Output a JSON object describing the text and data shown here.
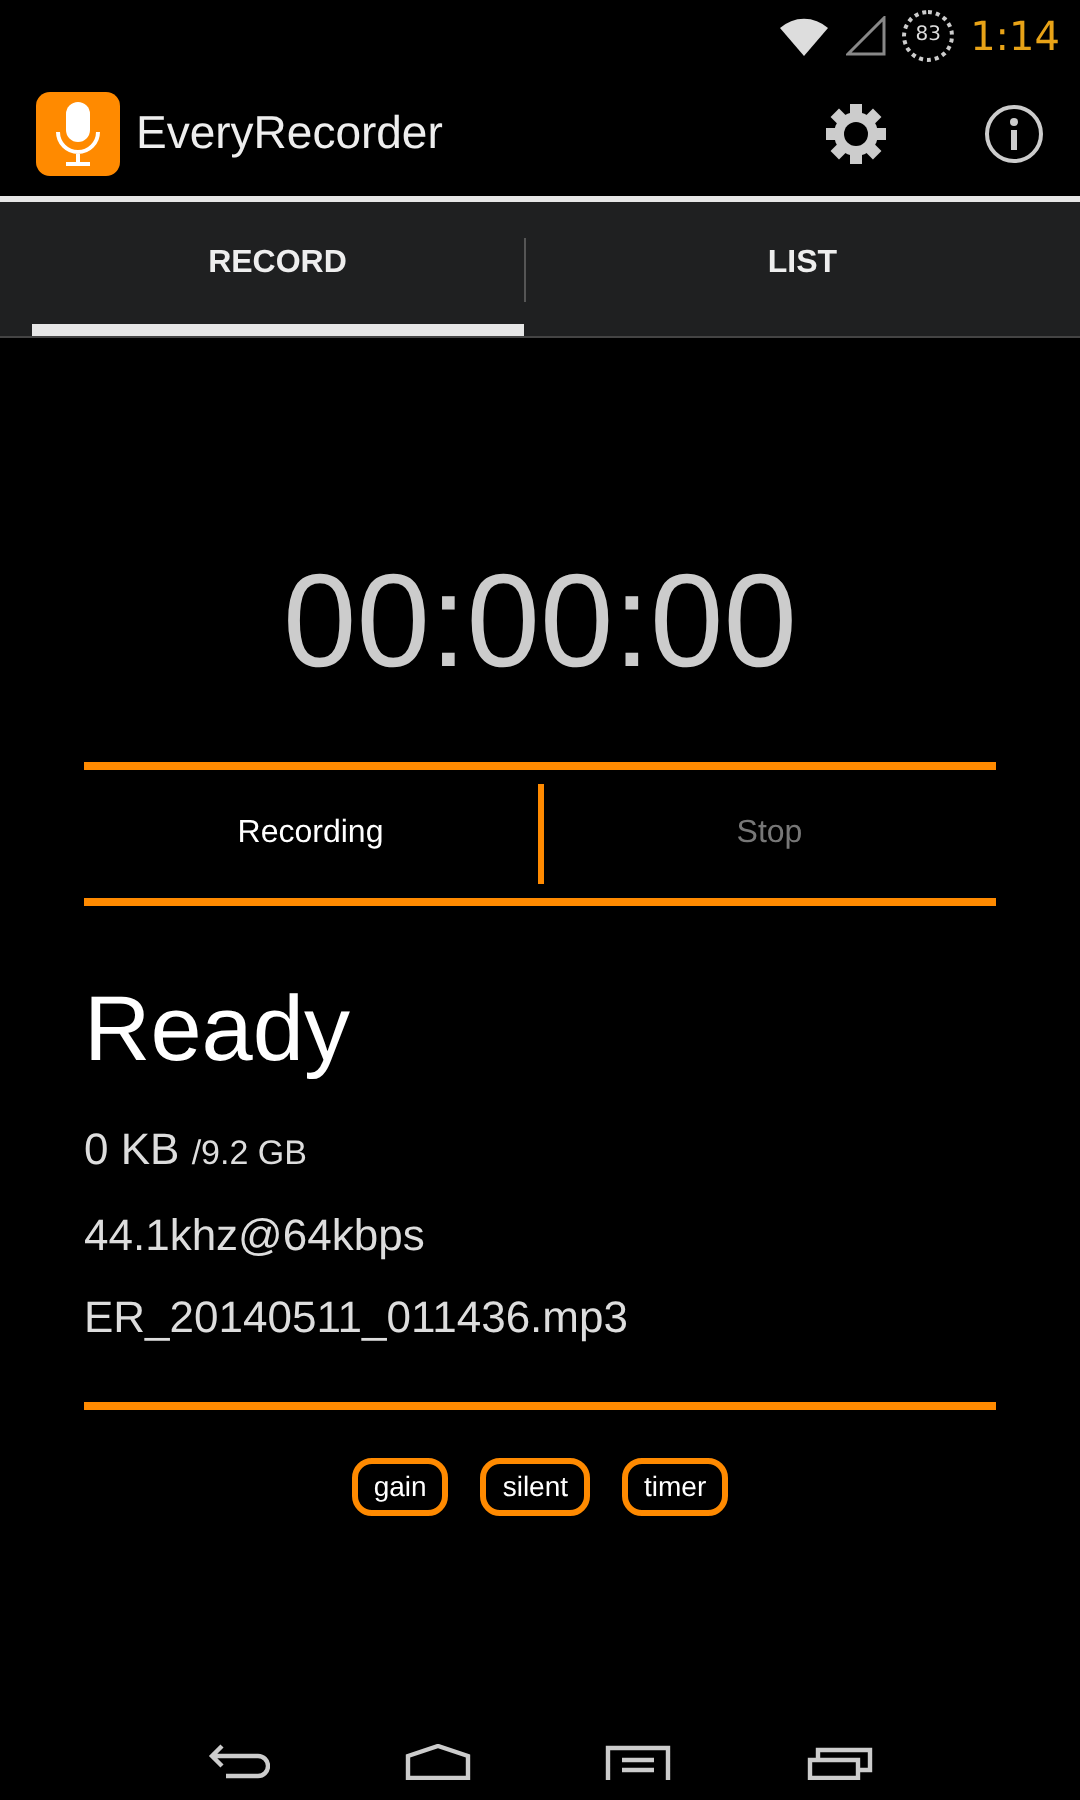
{
  "status_bar": {
    "battery": "83",
    "time": "1:14"
  },
  "app_bar": {
    "title": "EveryRecorder"
  },
  "tabs": [
    {
      "label": "RECORD",
      "selected": true
    },
    {
      "label": "LIST",
      "selected": false
    }
  ],
  "timer": "00:00:00",
  "controls": [
    {
      "label": "Recording",
      "disabled": false
    },
    {
      "label": "Stop",
      "disabled": true
    }
  ],
  "status": "Ready",
  "size": {
    "used": "0 KB",
    "total": "/9.2 GB"
  },
  "quality": "44.1khz@64kbps",
  "filename": "ER_20140511_011436.mp3",
  "options": [
    "gain",
    "silent",
    "timer"
  ]
}
